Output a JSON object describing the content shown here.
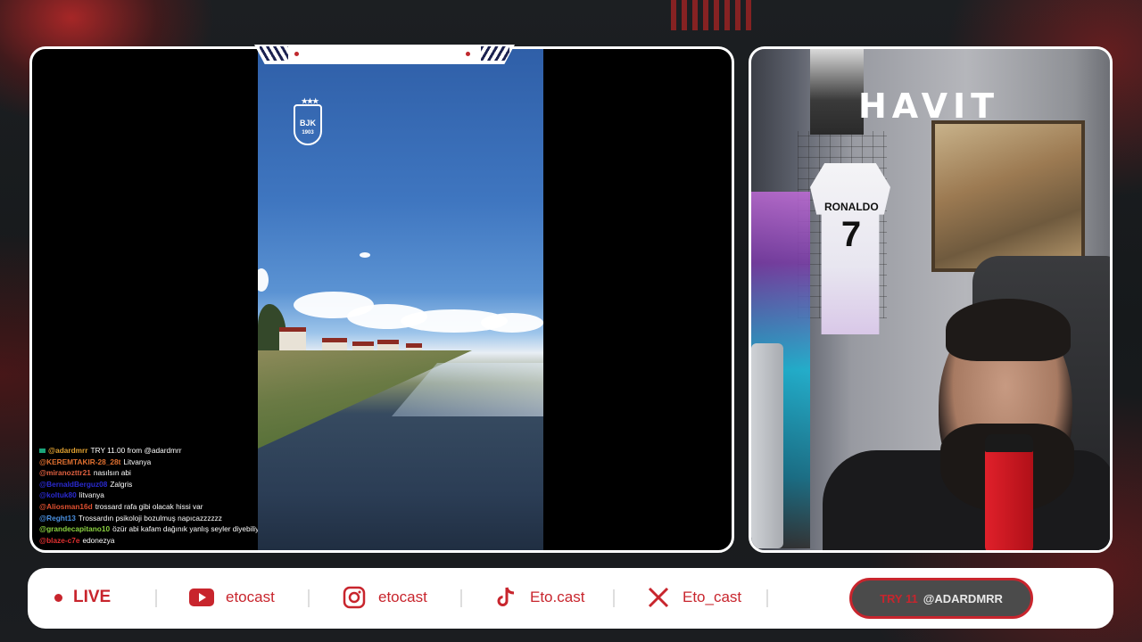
{
  "overlay": {
    "havit_logo": "HAVIT",
    "club_logo_text": "BJK",
    "club_logo_year": "1903"
  },
  "jersey": {
    "name": "RONALDO",
    "number": "7"
  },
  "chat": [
    {
      "user": "@adardmrr",
      "user_color": "#e0a030",
      "text": "TRY 11.00 from @adardmrr",
      "badge": true
    },
    {
      "user": "@KEREMTAKIR-28_28t",
      "user_color": "#e07030",
      "text": "Litvanya"
    },
    {
      "user": "@miranozttr21",
      "user_color": "#e06040",
      "text": "nasılsın abi"
    },
    {
      "user": "@BernaldBerguz08",
      "user_color": "#2a2ad0",
      "text": "Zalgris"
    },
    {
      "user": "@koltuk80",
      "user_color": "#2a2ad0",
      "text": "litvanya"
    },
    {
      "user": "@Aliosman16d",
      "user_color": "#e05030",
      "text": "trossard rafa gibi olacak hissi var"
    },
    {
      "user": "@Reght13",
      "user_color": "#4a90e0",
      "text": "Trossardın psikoloji bozulmuş napıcazzzzzz"
    },
    {
      "user": "@grandecapitano10",
      "user_color": "#8ad040",
      "text": "özür abi kafam dağınık yanlış seyler diyebiliyorum"
    },
    {
      "user": "@blaze-c7e",
      "user_color": "#e03030",
      "text": "edonezya"
    }
  ],
  "bottom_bar": {
    "live_label": "LIVE",
    "socials": [
      {
        "icon": "youtube-icon",
        "handle": "etocast"
      },
      {
        "icon": "instagram-icon",
        "handle": "etocast"
      },
      {
        "icon": "tiktok-icon",
        "handle": "Eto.cast"
      },
      {
        "icon": "x-icon",
        "handle": "Eto_cast"
      }
    ],
    "donation": {
      "amount": "TRY 11",
      "user": "@ADARDMRR"
    }
  },
  "colors": {
    "accent": "#c8252d",
    "frame": "#ffffff",
    "pill_bg": "#4b4b4b"
  }
}
